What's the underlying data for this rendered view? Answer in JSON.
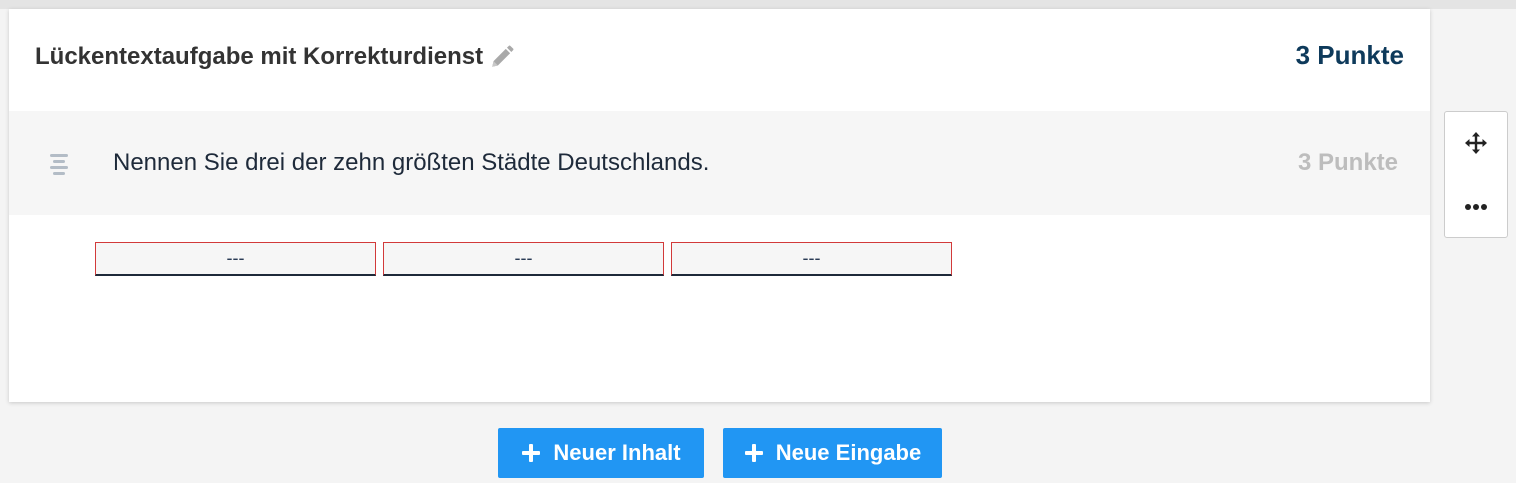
{
  "card": {
    "title": "Lückentextaufgabe mit Korrekturdienst",
    "points": "3 Punkte"
  },
  "question": {
    "text": "Nennen Sie drei der zehn größten Städte Deutschlands.",
    "points": "3 Punkte"
  },
  "gaps": [
    "---",
    "---",
    "---"
  ],
  "buttons": {
    "new_content": "Neuer Inhalt",
    "new_input": "Neue Eingabe"
  },
  "icons": {
    "edit": "pencil-icon",
    "drag": "text-align-icon",
    "move": "move-arrows-icon",
    "more": "ellipsis-icon",
    "add": "plus-icon"
  },
  "colors": {
    "primary_button": "#2196f3",
    "points_accent": "#0e3a5b",
    "gap_border": "#d23a3a"
  }
}
